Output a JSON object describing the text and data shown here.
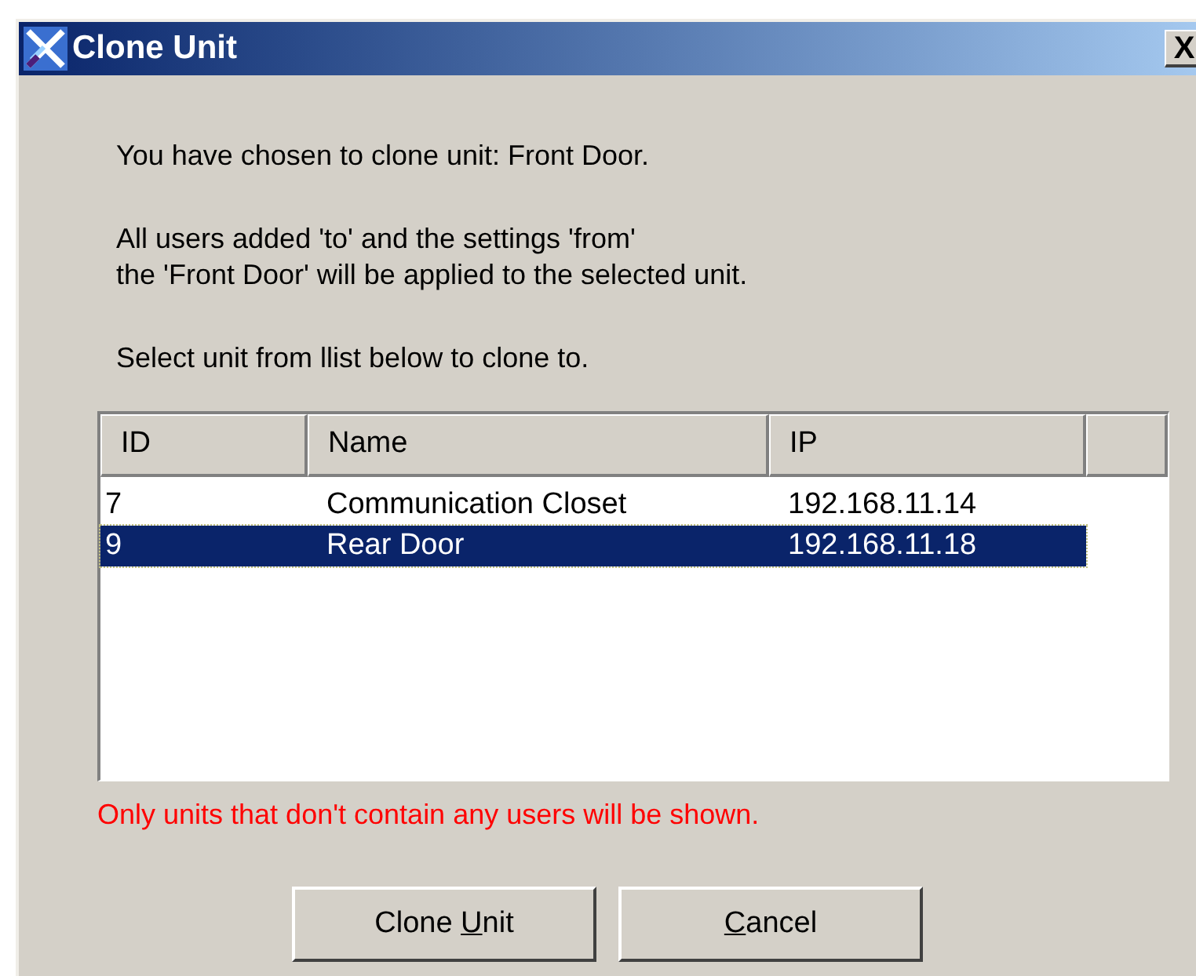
{
  "window": {
    "title": "Clone Unit",
    "close": "X"
  },
  "messages": [
    "You have chosen to clone unit: Front Door.",
    "All users added 'to' and the settings 'from'\nthe 'Front Door' will be applied to the selected unit.",
    "Select unit from llist below to clone to."
  ],
  "table": {
    "columns": [
      "ID",
      "Name",
      "IP"
    ],
    "rows": [
      {
        "cells": [
          "7",
          "Communication Closet",
          "192.168.11.14"
        ],
        "selected": false
      },
      {
        "cells": [
          "9",
          "Rear Door",
          "192.168.11.18"
        ],
        "selected": true
      }
    ]
  },
  "warning": "Only units that don't contain any users will be shown.",
  "buttons": [
    {
      "before": "Clone ",
      "key": "U",
      "after": "nit"
    },
    {
      "key": "C",
      "after": "ancel"
    }
  ]
}
